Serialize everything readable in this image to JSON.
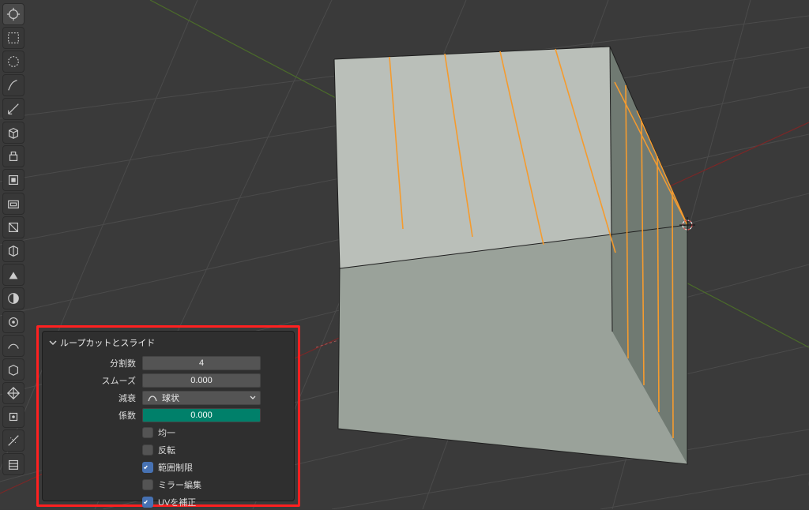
{
  "panel": {
    "title": "ループカットとスライド",
    "cuts_label": "分割数",
    "cuts_value": "4",
    "smooth_label": "スムーズ",
    "smooth_value": "0.000",
    "falloff_label": "減衰",
    "falloff_value": "球状",
    "factor_label": "係数",
    "factor_value": "0.000",
    "even_label": "均一",
    "flip_label": "反転",
    "clamp_label": "範囲制限",
    "mirror_label": "ミラー編集",
    "uv_label": "UVを補正"
  },
  "toolbar": {
    "items": [
      "cursor",
      "select-box",
      "scale-cage",
      "annotate",
      "measure",
      "add-cube",
      "extrude-region",
      "extrude-faces",
      "inset-faces",
      "bevel",
      "loop-cut",
      "knife",
      "poly-build",
      "spin",
      "smooth",
      "edge-slide",
      "shrink-fatten",
      "push-pull",
      "shear",
      "rip-region"
    ]
  }
}
